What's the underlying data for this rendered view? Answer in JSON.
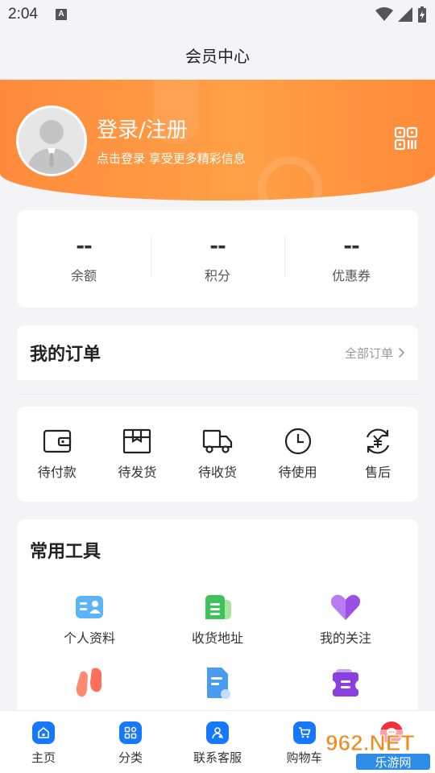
{
  "status_bar": {
    "time": "2:04",
    "notification_icon": "A"
  },
  "navbar": {
    "title": "会员中心"
  },
  "profile": {
    "login_title": "登录/注册",
    "login_subtitle": "点击登录 享受更多精彩信息",
    "avatar_icon": "default-avatar-icon",
    "qr_icon": "qr-code-icon"
  },
  "stats": [
    {
      "value": "--",
      "label": "余额"
    },
    {
      "value": "--",
      "label": "积分"
    },
    {
      "value": "--",
      "label": "优惠券"
    }
  ],
  "orders": {
    "title": "我的订单",
    "all_label": "全部订单",
    "items": [
      {
        "label": "待付款",
        "icon": "wallet-icon"
      },
      {
        "label": "待发货",
        "icon": "package-icon"
      },
      {
        "label": "待收货",
        "icon": "truck-icon"
      },
      {
        "label": "待使用",
        "icon": "clock-icon"
      },
      {
        "label": "售后",
        "icon": "yuan-refresh-icon"
      }
    ]
  },
  "tools": {
    "title": "常用工具",
    "items": [
      {
        "label": "个人资料",
        "icon": "profile-card-icon"
      },
      {
        "label": "收货地址",
        "icon": "address-icon"
      },
      {
        "label": "我的关注",
        "icon": "heart-icon"
      },
      {
        "label": "",
        "icon": "footprint-icon"
      },
      {
        "label": "",
        "icon": "document-icon"
      },
      {
        "label": "",
        "icon": "coupon-icon"
      }
    ]
  },
  "bottom_nav": [
    {
      "label": "主页",
      "icon": "home-icon"
    },
    {
      "label": "分类",
      "icon": "category-icon"
    },
    {
      "label": "联系客服",
      "icon": "customer-service-icon"
    },
    {
      "label": "购物车",
      "icon": "cart-icon"
    },
    {
      "label": "",
      "icon": "chat-bubble-icon"
    }
  ],
  "watermark": {
    "text": "962.NET",
    "subtext": "乐游网"
  },
  "colors": {
    "accent": "#1677ff",
    "header_orange": "#ff9a42",
    "badge_red": "#f0303a"
  }
}
